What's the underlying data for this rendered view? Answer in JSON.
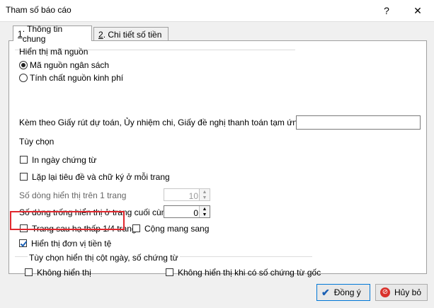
{
  "window": {
    "title": "Tham số báo cáo",
    "help": "?",
    "close": "✕"
  },
  "tabs": [
    {
      "num": "1",
      "label": ". Thông tin chung"
    },
    {
      "num": "2",
      "label": ". Chi tiết số tiền"
    }
  ],
  "source": {
    "group_label": "Hiển thị mã nguồn",
    "option1": "Mã nguồn ngân sách",
    "option2": "Tính chất nguồn kinh phí"
  },
  "attach": {
    "label": "Kèm theo Giấy rút dự toán, Ủy nhiệm chi, Giấy đề nghị thanh toán tạm ứng số",
    "value": ""
  },
  "options": {
    "group_label": "Tùy chọn",
    "print_date": "In ngày chứng từ",
    "repeat_header": "Lặp lại tiêu đề và chữ ký ở mỗi trang",
    "rows_per_page_label": "Số dòng hiển thị trên 1 trang",
    "rows_per_page_value": "10",
    "empty_rows_label": "Số dòng trống hiển thị ở trang cuối cùng",
    "empty_rows_value": "0",
    "page_after": "Trang sau hạ thấp 1/4 trang",
    "carry_forward": "Cộng mang sang",
    "show_currency": "Hiển thị đơn vị tiền tệ"
  },
  "date_col": {
    "group_label": "Tùy chọn hiển thị cột ngày, số chứng từ",
    "no_show": "Không hiển thị",
    "no_show_original": "Không hiển thị khi có số chứng từ gốc"
  },
  "buttons": {
    "ok": "Đồng ý",
    "cancel": "Hủy bỏ"
  }
}
